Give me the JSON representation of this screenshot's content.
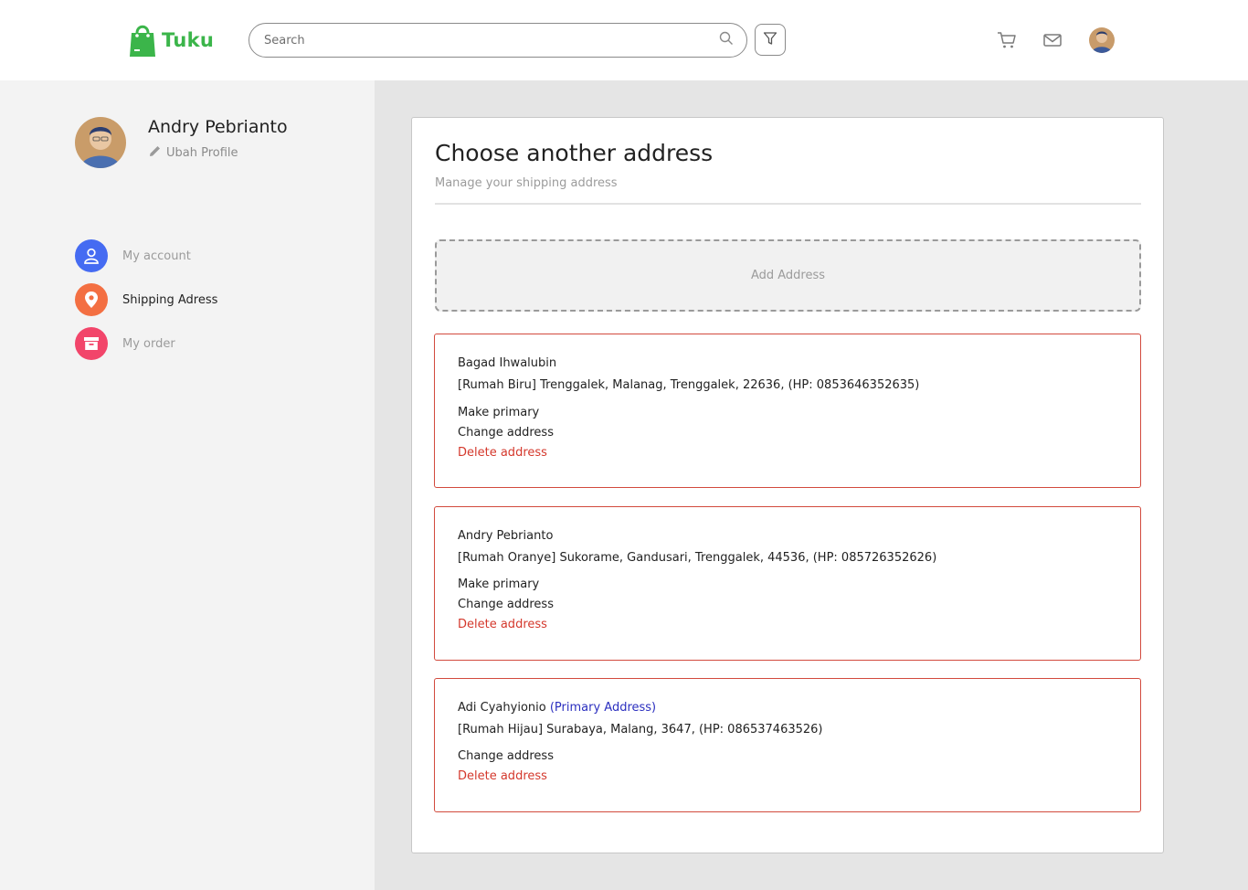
{
  "header": {
    "brand": "Tuku",
    "brand_color": "#3bb54a",
    "search_placeholder": "Search",
    "icons": [
      "search-icon",
      "filter-icon",
      "cart-icon",
      "mail-icon"
    ]
  },
  "profile": {
    "name": "Andry Pebrianto",
    "edit_label": "Ubah Profile"
  },
  "sidebar": {
    "items": [
      {
        "label": "My account",
        "icon": "user-icon",
        "color": "#456bf2",
        "active": false
      },
      {
        "label": "Shipping Adress",
        "icon": "location-pin-icon",
        "color": "#f36f42",
        "active": true
      },
      {
        "label": "My order",
        "icon": "archive-box-icon",
        "color": "#f2456a",
        "active": false
      }
    ]
  },
  "main": {
    "title": "Choose another address",
    "subtitle": "Manage your shipping address",
    "add_label": "Add Address",
    "addresses": [
      {
        "name": "Bagad Ihwalubin",
        "primary_tag": "",
        "detail": "[Rumah Biru] Trenggalek, Malanag, Trenggalek, 22636, (HP: 0853646352635)",
        "make_primary": "Make primary",
        "change": "Change address",
        "delete": "Delete address"
      },
      {
        "name": "Andry Pebrianto",
        "primary_tag": "",
        "detail": "[Rumah Oranye] Sukorame, Gandusari, Trenggalek, 44536, (HP: 085726352626)",
        "make_primary": "Make primary",
        "change": "Change address",
        "delete": "Delete address"
      },
      {
        "name": "Adi Cyahyionio",
        "primary_tag": "(Primary Address)",
        "detail": "[Rumah Hijau] Surabaya, Malang, 3647, (HP: 086537463526)",
        "make_primary": "",
        "change": "Change address",
        "delete": "Delete address"
      }
    ]
  },
  "colors": {
    "accent_border": "#d24a3d",
    "delete_text": "#d4382c",
    "primary_tag": "#2b2fbf"
  }
}
